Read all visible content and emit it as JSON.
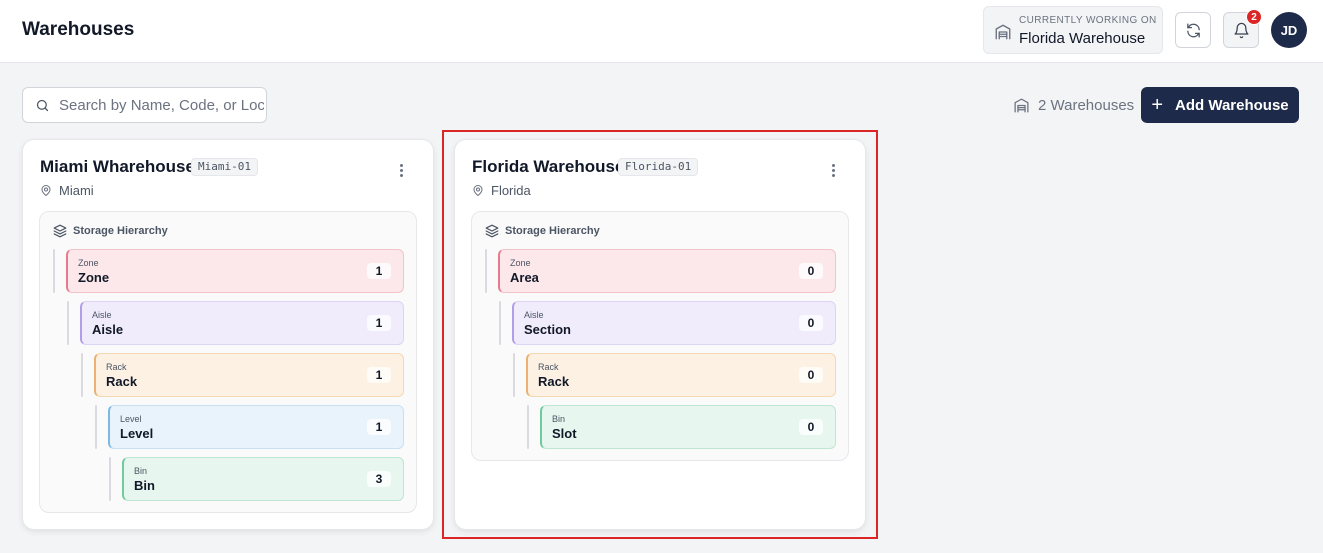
{
  "header": {
    "title": "Warehouses",
    "working_label": "CURRENTLY WORKING ON",
    "working_value": "Florida Warehouse",
    "notification_count": "2",
    "avatar_initials": "JD"
  },
  "toolbar": {
    "search_placeholder": "Search by Name, Code, or Location...",
    "warehouse_count": "2 Warehouses",
    "add_label": "Add Warehouse"
  },
  "hierarchy_label": "Storage Hierarchy",
  "warehouses": [
    {
      "name": "Miami Wharehouse",
      "code": "Miami-01",
      "location": "Miami",
      "levels": [
        {
          "type": "Zone",
          "name": "Zone",
          "count": "1"
        },
        {
          "type": "Aisle",
          "name": "Aisle",
          "count": "1"
        },
        {
          "type": "Rack",
          "name": "Rack",
          "count": "1"
        },
        {
          "type": "Level",
          "name": "Level",
          "count": "1"
        },
        {
          "type": "Bin",
          "name": "Bin",
          "count": "3"
        }
      ]
    },
    {
      "name": "Florida Warehouse",
      "code": "Florida-01",
      "location": "Florida",
      "levels": [
        {
          "type": "Zone",
          "name": "Area",
          "count": "0"
        },
        {
          "type": "Aisle",
          "name": "Section",
          "count": "0"
        },
        {
          "type": "Rack",
          "name": "Rack",
          "count": "0"
        },
        {
          "type": "Bin",
          "name": "Slot",
          "count": "0"
        }
      ]
    }
  ],
  "colors": {
    "primary": "#1e2a4a",
    "notification_badge": "#dc2626",
    "highlight_border": "#dc2626",
    "zone": "#fce8ea",
    "aisle": "#f0ecfb",
    "rack": "#fdf1e4",
    "level": "#e9f3fb",
    "bin": "#e7f6ef"
  },
  "icons": {
    "working": "warehouse-icon",
    "refresh": "refresh-icon",
    "notifications": "bell-icon",
    "search": "search-icon",
    "count": "warehouse-icon",
    "add": "plus-icon",
    "card_menu": "more-vertical-icon",
    "location": "map-pin-icon",
    "hierarchy": "layers-icon"
  }
}
